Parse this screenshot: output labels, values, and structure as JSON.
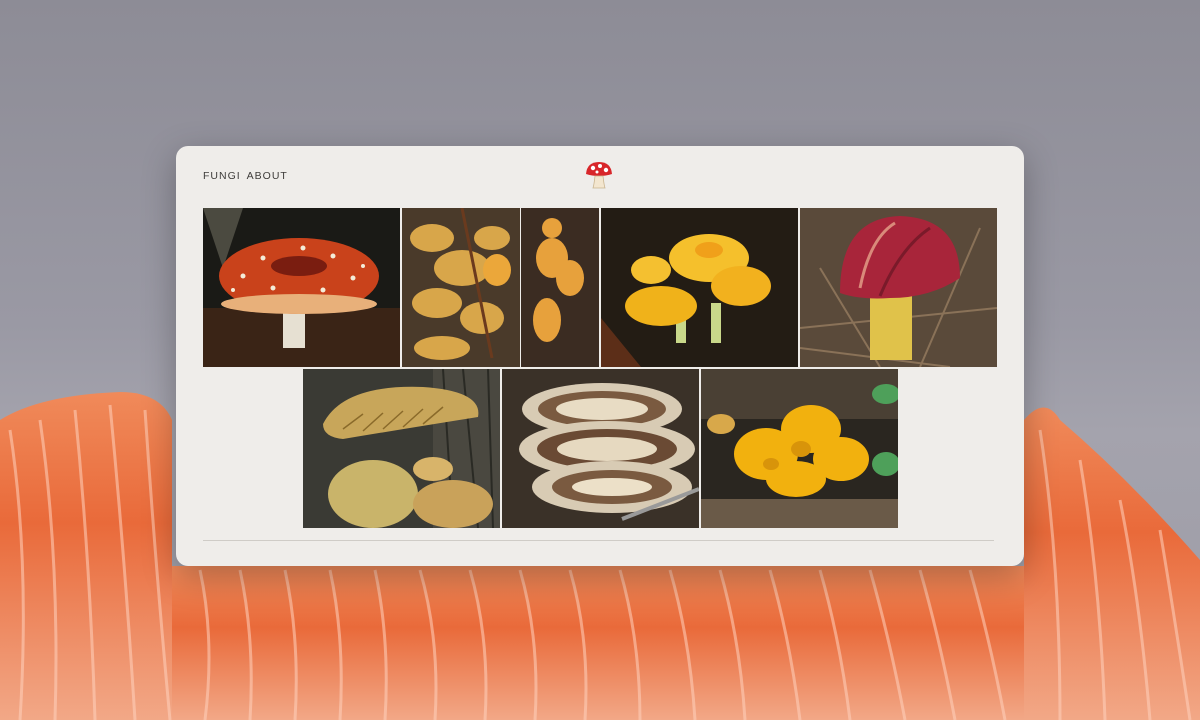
{
  "nav": {
    "links": [
      {
        "label": "FUNGI"
      },
      {
        "label": "ABOUT"
      }
    ]
  },
  "logo": {
    "icon": "mushroom-icon"
  },
  "gallery": {
    "photos": [
      {
        "id": "fly-agaric",
        "icon": "red-mushroom-photo"
      },
      {
        "id": "chanterelle-cluster",
        "icon": "orange-fungus-photo"
      },
      {
        "id": "yellow-waxcap",
        "icon": "yellow-mushroom-photo"
      },
      {
        "id": "red-russula",
        "icon": "red-cap-mushroom-photo"
      },
      {
        "id": "gilled-bracket",
        "icon": "tan-gilled-mushroom-photo"
      },
      {
        "id": "turkey-tail",
        "icon": "turkey-tail-photo"
      },
      {
        "id": "witches-butter",
        "icon": "yellow-jelly-fungus-photo"
      }
    ]
  },
  "colors": {
    "card": "#efedea",
    "backdrop": "#8f8e99",
    "gills": "#e8693a"
  }
}
